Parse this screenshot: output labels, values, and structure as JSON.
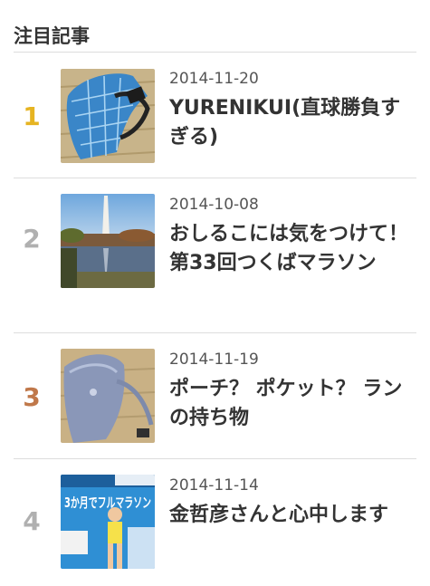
{
  "widget": {
    "title": "注目記事"
  },
  "articles": [
    {
      "rank": "1",
      "rank_color": "#e6b422",
      "date": "2014-11-20",
      "title": "YURENIKUI(直球勝負すぎる)",
      "thumb_icon": "blue-plaid-bag-photo"
    },
    {
      "rank": "2",
      "rank_color": "#b0b0b0",
      "date": "2014-10-08",
      "title": "おしるこには気をつけて！　第33回つくばマラソン",
      "thumb_icon": "monument-lake-photo"
    },
    {
      "rank": "3",
      "rank_color": "#c0784a",
      "date": "2014-11-19",
      "title": "ポーチ？ ポケット？ ランの持ち物",
      "thumb_icon": "grey-waist-pouch-photo"
    },
    {
      "rank": "4",
      "rank_color": "#b0b0b0",
      "date": "2014-11-14",
      "title": "金哲彦さんと心中します",
      "thumb_icon": "marathon-magazine-cover-photo"
    }
  ],
  "thumb4_cover_text": "3か月でフルマラソン"
}
